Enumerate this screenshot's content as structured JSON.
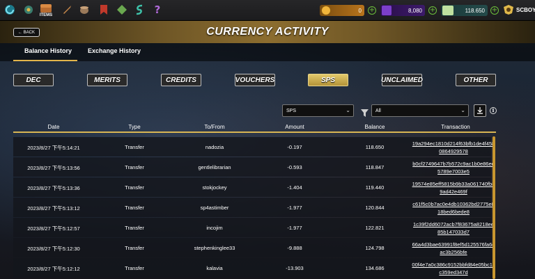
{
  "topnav": {
    "items_label": "ITEMS",
    "resources": {
      "gold": "0",
      "purple": "8,080",
      "credits": "118.650"
    },
    "username": "SCBOY"
  },
  "header": {
    "back_label": "← BACK",
    "title": "CURRENCY ACTIVITY"
  },
  "tabs": [
    {
      "label": "Balance History",
      "active": true
    },
    {
      "label": "Exchange History",
      "active": false
    }
  ],
  "currency_filters": [
    "DEC",
    "MERITS",
    "CREDITS",
    "VOUCHERS",
    "SPS",
    "UNCLAIMED",
    "OTHER"
  ],
  "active_filter": "SPS",
  "token_select": {
    "value": "SPS"
  },
  "type_select": {
    "value": "All"
  },
  "table": {
    "headers": [
      "Date",
      "Type",
      "To/From",
      "Amount",
      "Balance",
      "Transaction"
    ],
    "rows": [
      {
        "date": "2023/8/27 下午5:14:21",
        "type": "Transfer",
        "to_from": "nadozia",
        "amount": "-0.197",
        "balance": "118.650",
        "tx": "19a294ec1810d214f63bfb1de4f4580864929578"
      },
      {
        "date": "2023/8/27 下午5:13:56",
        "type": "Transfer",
        "to_from": "gentlelibrarian",
        "amount": "-0.593",
        "balance": "118.847",
        "tx": "b0cf2749647b7b572c9ac1b0e86ee5789e7003e5"
      },
      {
        "date": "2023/8/27 下午5:13:36",
        "type": "Transfer",
        "to_from": "stokjockey",
        "amount": "-1.404",
        "balance": "119.440",
        "tx": "19574e85eff5815b9b33a061740fb89ad42e469f"
      },
      {
        "date": "2023/8/27 下午5:13:12",
        "type": "Transfer",
        "to_from": "sp4astimber",
        "amount": "-1.977",
        "balance": "120.844",
        "tx": "c61f5c0b7ac0e4db10362bd2775e818bed6bede8"
      },
      {
        "date": "2023/8/27 下午5:12:57",
        "type": "Transfer",
        "to_from": "incojim",
        "amount": "-1.977",
        "balance": "122.821",
        "tx": "1c39f2dd6072acb7f83675a8218ee85b147033d7"
      },
      {
        "date": "2023/8/27 下午5:12:30",
        "type": "Transfer",
        "to_from": "stephenkinglee33",
        "amount": "-9.888",
        "balance": "124.798",
        "tx": "66a4d3bae63991f8ef5d125576fa6dac3b256bfe"
      },
      {
        "date": "2023/8/27 下午5:12:12",
        "type": "Transfer",
        "to_from": "kalavia",
        "amount": "-13.903",
        "balance": "134.686",
        "tx": "00f4e7a0c386c9152bbfd84e05bc11c359ed347d"
      }
    ]
  },
  "colors": {
    "accent_gold": "#e3b54a",
    "active_filter_bg": "#c9a94d"
  }
}
